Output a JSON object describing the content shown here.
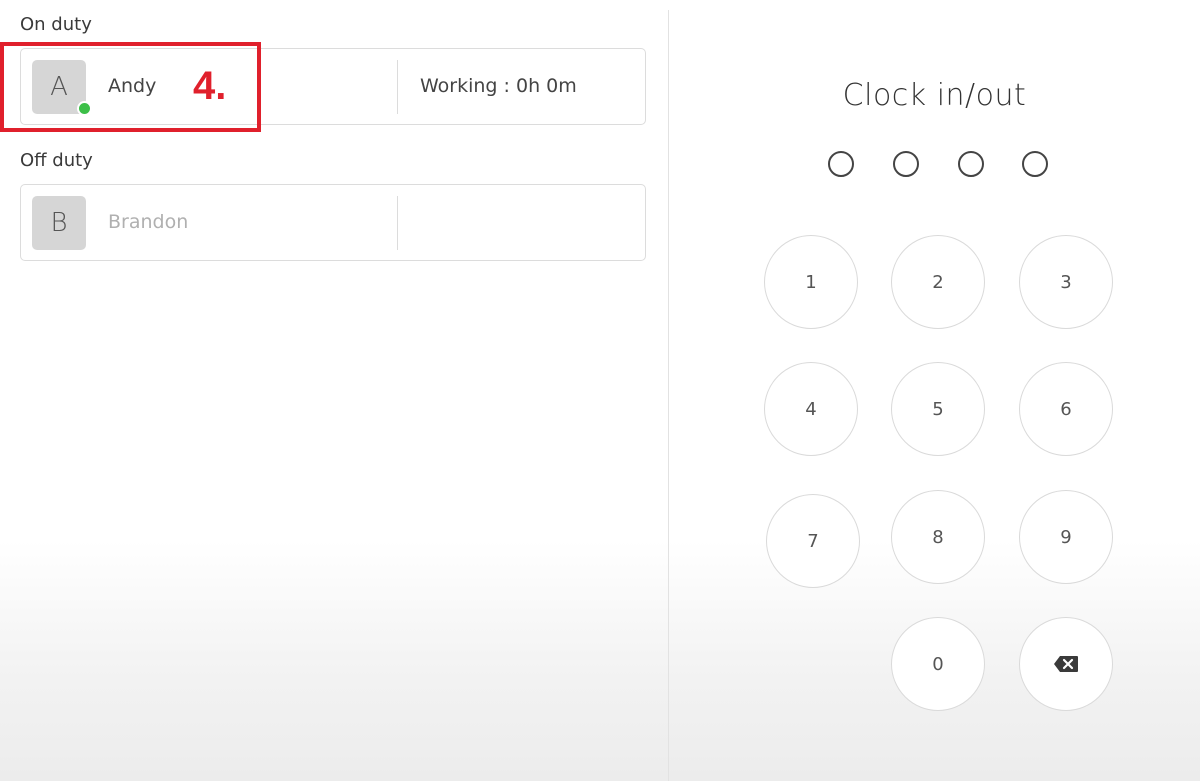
{
  "on_duty": {
    "label": "On duty",
    "staff": [
      {
        "initial": "A",
        "name": "Andy",
        "status": "Working : 0h 0m",
        "online": true
      }
    ]
  },
  "off_duty": {
    "label": "Off duty",
    "staff": [
      {
        "initial": "B",
        "name": "Brandon",
        "status": ""
      }
    ]
  },
  "annotation": {
    "step": "4.",
    "color": "#e0202c"
  },
  "clock": {
    "title": "Clock in/out",
    "pin_length": 4,
    "keys": [
      "1",
      "2",
      "3",
      "4",
      "5",
      "6",
      "7",
      "8",
      "9",
      "0"
    ],
    "backspace_icon": "backspace-icon"
  },
  "colors": {
    "online": "#3cbf48",
    "highlight": "#e0202c"
  }
}
